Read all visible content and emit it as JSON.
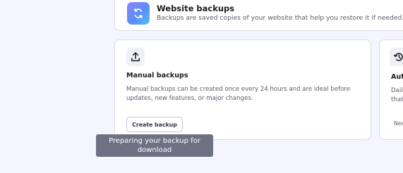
{
  "website_backups": {
    "title": "Website backups",
    "description": "Backups are saved copies of your website that help you restore it if needed.",
    "icon": "backup-restore-icon"
  },
  "manual_backups": {
    "icon": "upload-icon",
    "title": "Manual backups",
    "description": "Manual backups can be created once every 24 hours and are ideal before updates, new features, or major changes.",
    "button_label": "Create backup"
  },
  "auto_backups": {
    "icon": "history-icon",
    "title_fragment": "Aut",
    "description_lines": [
      "Daily",
      "that"
    ],
    "next_fragment": "Nex"
  },
  "tooltip": {
    "text": "Preparing your backup for download"
  },
  "colors": {
    "background": "#f4f5ff",
    "card": "#ffffff",
    "border": "#dadce0",
    "tooltip": "#6e7083",
    "icon_gradient_start": "#8c85ff",
    "icon_gradient_end": "#4ec3ef"
  }
}
